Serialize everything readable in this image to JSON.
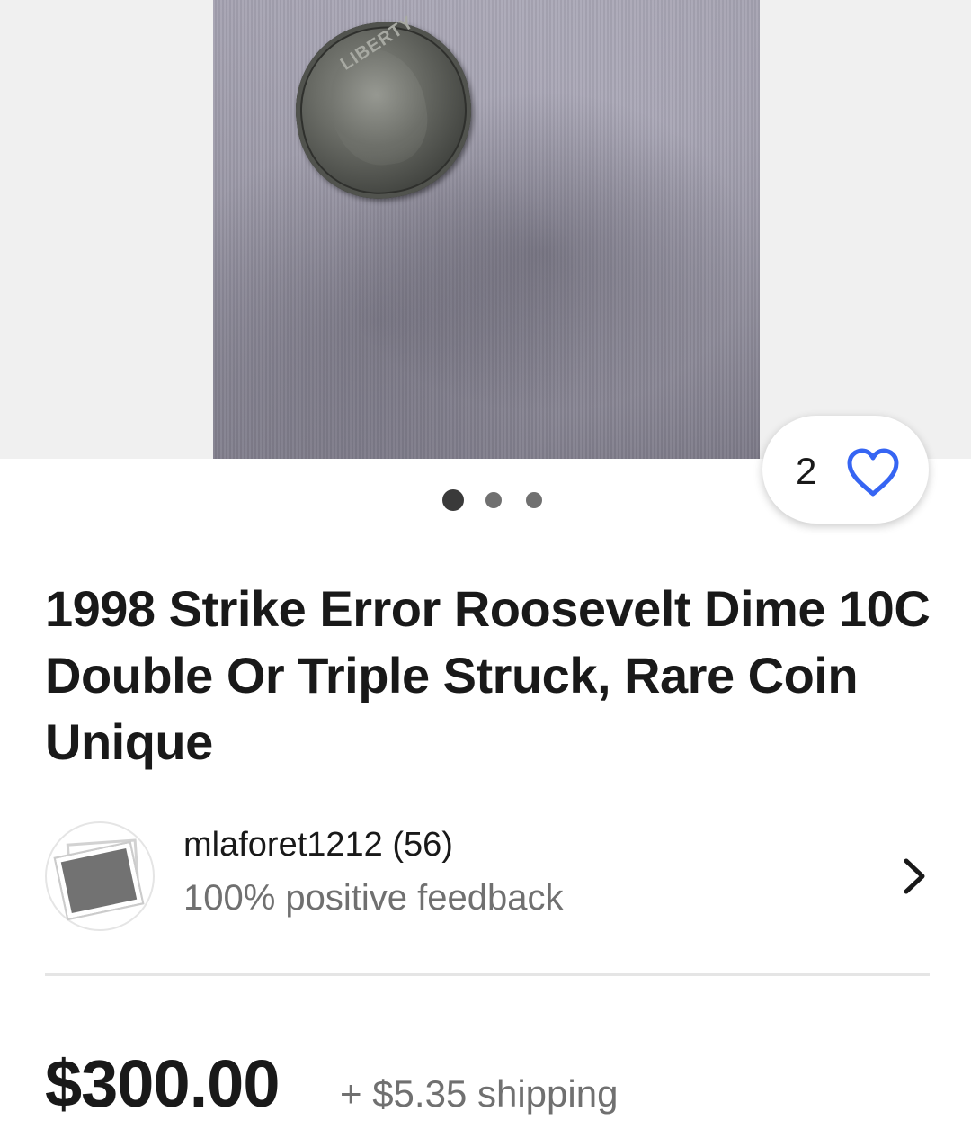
{
  "gallery": {
    "image_count": 3,
    "active_index": 0,
    "coin_text": "LIBERTY"
  },
  "watch": {
    "count": "2"
  },
  "listing": {
    "title": "1998 Strike Error Roosevelt Dime 10C Double Or Triple Struck, Rare Coin Unique"
  },
  "seller": {
    "name": "mlaforet1212 (56)",
    "feedback": "100% positive feedback"
  },
  "pricing": {
    "price": "$300.00",
    "shipping": "+ $5.35 shipping"
  },
  "colors": {
    "accent": "#3665f3",
    "text": "#191919",
    "secondary_text": "#707070"
  }
}
